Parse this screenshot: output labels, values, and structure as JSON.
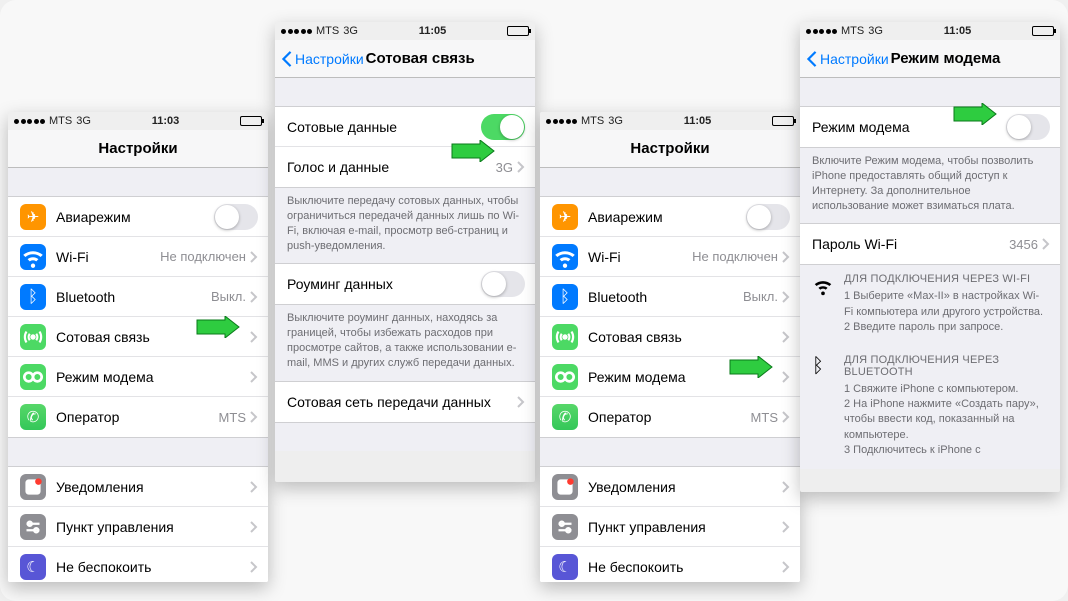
{
  "screen1": {
    "status": {
      "carrier": "MTS",
      "net": "3G",
      "time": "11:03"
    },
    "title": "Настройки",
    "rows": {
      "airplane": "Авиарежим",
      "wifi": "Wi-Fi",
      "wifi_val": "Не подключен",
      "bt": "Bluetooth",
      "bt_val": "Выкл.",
      "cellular": "Сотовая связь",
      "hotspot": "Режим модема",
      "carrier": "Оператор",
      "carrier_val": "MTS",
      "notif": "Уведомления",
      "cc": "Пункт управления",
      "dnd": "Не беспокоить"
    }
  },
  "screen2": {
    "status": {
      "carrier": "MTS",
      "net": "3G",
      "time": "11:05"
    },
    "back": "Настройки",
    "title": "Сотовая связь",
    "rows": {
      "data": "Сотовые данные",
      "voice": "Голос и данные",
      "voice_val": "3G",
      "roaming": "Роуминг данных",
      "apn": "Сотовая сеть передачи данных"
    },
    "note1": "Выключите передачу сотовых данных, чтобы ограничиться передачей данных лишь по Wi-Fi, включая e-mail, просмотр веб-страниц и push-уведомления.",
    "note2": "Выключите роуминг данных, находясь за границей, чтобы избежать расходов при просмотре сайтов, а также использовании e-mail, MMS и других служб передачи данных."
  },
  "screen3": {
    "status": {
      "carrier": "MTS",
      "net": "3G",
      "time": "11:05"
    },
    "title": "Настройки",
    "rows": {
      "airplane": "Авиарежим",
      "wifi": "Wi-Fi",
      "wifi_val": "Не подключен",
      "bt": "Bluetooth",
      "bt_val": "Выкл.",
      "cellular": "Сотовая связь",
      "hotspot": "Режим модема",
      "carrier": "Оператор",
      "carrier_val": "MTS",
      "notif": "Уведомления",
      "cc": "Пункт управления",
      "dnd": "Не беспокоить"
    }
  },
  "screen4": {
    "status": {
      "carrier": "MTS",
      "net": "3G",
      "time": "11:05"
    },
    "back": "Настройки",
    "title": "Режим модема",
    "rows": {
      "hotspot": "Режим модема",
      "wifi_pass": "Пароль Wi-Fi",
      "wifi_pass_val": "3456"
    },
    "note1": "Включите Режим модема, чтобы позволить iPhone предоставлять общий доступ к Интернету. За дополнительное использование может взиматься плата.",
    "wifi_head": "ДЛЯ ПОДКЛЮЧЕНИЯ ЧЕРЕЗ WI-FI",
    "wifi_1": "1 Выберите «Max-II» в настройках Wi-Fi компьютера или другого устройства.",
    "wifi_2": "2 Введите пароль при запросе.",
    "bt_head": "ДЛЯ ПОДКЛЮЧЕНИЯ ЧЕРЕЗ BLUETOOTH",
    "bt_1": "1 Свяжите iPhone с компьютером.",
    "bt_2": "2 На iPhone нажмите «Создать пару», чтобы ввести код, показанный на компьютере.",
    "bt_3": "3 Подключитесь к iPhone с"
  }
}
